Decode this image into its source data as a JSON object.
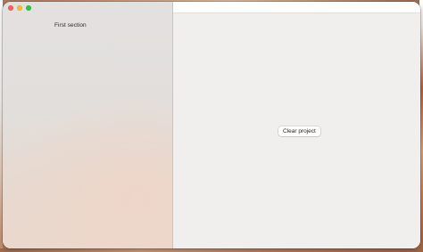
{
  "sidebar": {
    "section_header": "First section"
  },
  "main": {
    "clear_button_label": "Clear project"
  },
  "window_controls": {
    "close_color": "#fe5f57",
    "minimize_color": "#febc2e",
    "zoom_color": "#28c840"
  }
}
